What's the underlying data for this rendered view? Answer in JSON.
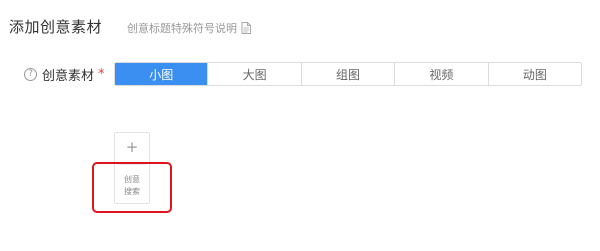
{
  "header": {
    "title": "添加创意素材",
    "link_text": "创意标题特殊符号说明",
    "link_icon": "document-icon"
  },
  "form": {
    "help_icon_glyph": "?",
    "label": "创意素材",
    "required_mark": "*"
  },
  "tabs": [
    {
      "label": "小图",
      "active": true
    },
    {
      "label": "大图",
      "active": false
    },
    {
      "label": "组图",
      "active": false
    },
    {
      "label": "视频",
      "active": false
    },
    {
      "label": "动图",
      "active": false
    }
  ],
  "upload": {
    "plus": "+",
    "line1": "创意",
    "line2": "搜索"
  },
  "colors": {
    "accent": "#3a8ff0",
    "required": "#e83e3e",
    "highlight": "#e0141e"
  }
}
